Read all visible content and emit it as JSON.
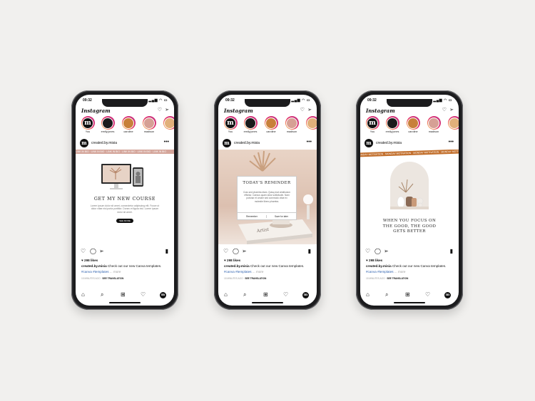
{
  "colors": {
    "background": "#f1f0ee",
    "brand_rose": "#d4a59a",
    "brand_orange": "#c26f2c",
    "link_blue": "#2b5fae",
    "story_colors": [
      "#1b1b1b",
      "#1b1b1b",
      "#c8803a",
      "#d6a095",
      "#e1b07a"
    ]
  },
  "phones": [
    {
      "status": {
        "time": "09:32"
      },
      "app_name": "Instagram",
      "stories": [
        {
          "name": "You",
          "letter": "m"
        },
        {
          "name": "emily.jones",
          "letter": ""
        },
        {
          "name": "caroline",
          "letter": ""
        },
        {
          "name": "madison",
          "letter": ""
        }
      ],
      "post": {
        "username": "created.by.misia",
        "avatar_letter": "m",
        "ticker": "LINK IN BIO · LINK IN BIO · LINK IN BIO · LINK IN BIO · LINK IN BIO · LINK IN BIO",
        "headline": "GET MY NEW COURSE",
        "body": "Lorem ipsum dolor sit amet, consectetur adipiscing elit. Fusce ut dolor vitae nisi porta porttitor. Donec et ligula nisl. Lorem ipsum dolor sit amet.",
        "button": "SEE MORE",
        "likes": "298 likes",
        "caption_user": "created.by.misia",
        "caption_text": "Check out our new Canva templates.",
        "tags": "#canva #templates",
        "more": "... more",
        "time_ago": "15 MINUTES AGO",
        "translate": "SEE TRANSLATION"
      }
    },
    {
      "status": {
        "time": "09:32"
      },
      "app_name": "Instagram",
      "stories": [
        {
          "name": "You",
          "letter": "m"
        },
        {
          "name": "emily.jones",
          "letter": ""
        },
        {
          "name": "caroline",
          "letter": ""
        },
        {
          "name": "madison",
          "letter": ""
        }
      ],
      "post": {
        "username": "created.by.misia",
        "avatar_letter": "m",
        "headline": "TODAY'S REMINDER",
        "body": "Cras sed pharetra diam. Quisq erat vestibulum efficitur. Caecus quam dolor sollicitudin. Nam pulvinar et ornare sed commodo vitae ex molestie libero pharetra.",
        "button_left": "Remember",
        "button_right": "Save for later",
        "book_title": "Artist",
        "likes": "298 likes",
        "caption_user": "created.by.misia",
        "caption_text": "Check out our new Canva templates.",
        "tags": "#canva #templates",
        "more": "... more",
        "time_ago": "15 MINUTES AGO",
        "translate": "SEE TRANSLATION"
      }
    },
    {
      "status": {
        "time": "09:32"
      },
      "app_name": "Instagram",
      "stories": [
        {
          "name": "You",
          "letter": "m"
        },
        {
          "name": "emily.jones",
          "letter": ""
        },
        {
          "name": "caroline",
          "letter": ""
        },
        {
          "name": "madison",
          "letter": ""
        }
      ],
      "post": {
        "username": "created.by.misia",
        "avatar_letter": "m",
        "ticker": "MONDAY MOTIVATION · MONDAY MOTIVATION · MONDAY MOTIVATION · MONDAY MOTIVATION",
        "quote_line1": "WHEN YOU FOCUS ON",
        "quote_line2": "THE GOOD, THE GOOD",
        "quote_line3": "GETS BETTER",
        "likes": "298 likes",
        "caption_user": "created.by.misia",
        "caption_text": "Check out our new Canva templates.",
        "tags": "#canva #templates",
        "more": "... more",
        "time_ago": "15 MINUTES AGO",
        "translate": "SEE TRANSLATION"
      }
    }
  ]
}
